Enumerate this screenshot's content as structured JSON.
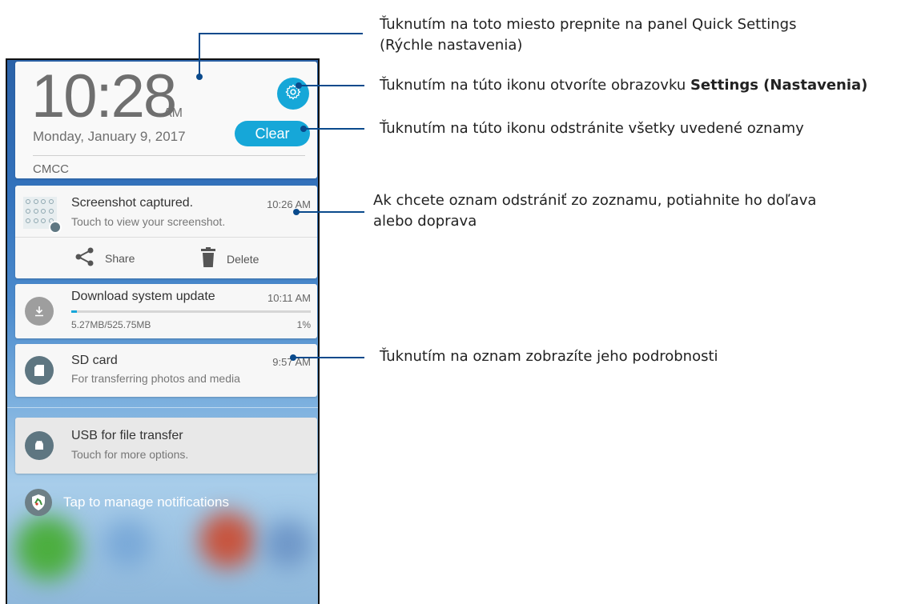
{
  "header": {
    "clock": "10:28",
    "ampm": "AM",
    "date": "Monday, January 9, 2017",
    "clear_label": "Clear",
    "carrier": "CMCC"
  },
  "notifications": [
    {
      "title": "Screenshot captured.",
      "time": "10:26 AM",
      "subtitle": "Touch to view your screenshot.",
      "actions": {
        "share": "Share",
        "delete": "Delete"
      }
    },
    {
      "title": "Download system update",
      "time": "10:11 AM",
      "size": "5.27MB/525.75MB",
      "percent_label": "1%",
      "progress": 0.01
    },
    {
      "title": "SD card",
      "time": "9:57 AM",
      "subtitle": "For transferring photos and media"
    },
    {
      "title": "USB for file transfer",
      "subtitle": "Touch for more options."
    }
  ],
  "manage_label": "Tap to manage notifications",
  "annotations": {
    "quick_settings": [
      "Ťuknutím na toto miesto prepnite na panel Quick Settings",
      "(Rýchle nastavenia)"
    ],
    "settings_prefix": "Ťuknutím na túto ikonu otvoríte obrazovku ",
    "settings_bold": "Settings (Nastavenia)",
    "clear": "Ťuknutím na túto ikonu odstránite všetky uvedené oznamy",
    "swipe": [
      "Ak chcete oznam odstrániť zo zoznamu, potiahnite ho doľava",
      "alebo doprava"
    ],
    "details": "Ťuknutím na oznam zobrazíte jeho podrobnosti"
  },
  "colors": {
    "accent": "#16a7d8",
    "annotation": "#0a4a8c"
  }
}
